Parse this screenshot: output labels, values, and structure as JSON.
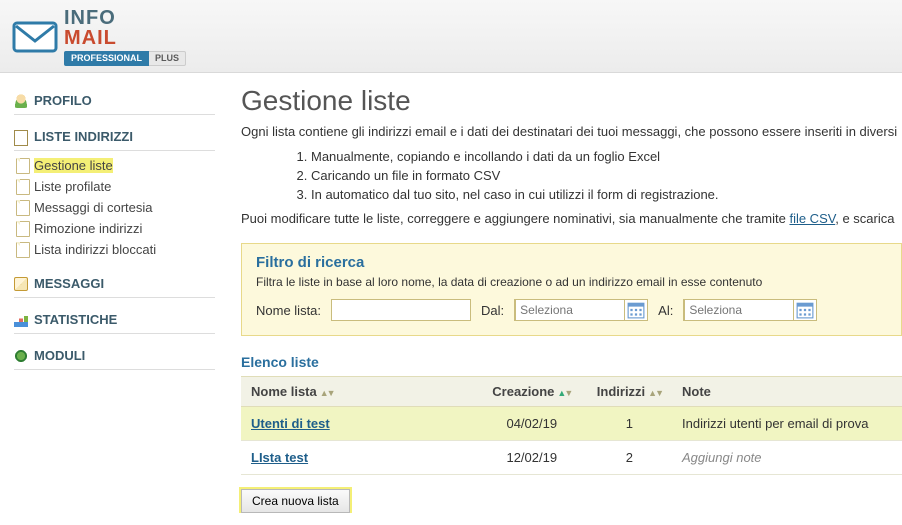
{
  "logo": {
    "line1": "INFO",
    "line2": "MAIL",
    "badge1": "PROFESSIONAL",
    "badge2": "PLUS"
  },
  "nav": {
    "profilo": "PROFILO",
    "liste": "LISTE INDIRIZZI",
    "liste_items": [
      {
        "label": "Gestione liste",
        "active": true
      },
      {
        "label": "Liste profilate"
      },
      {
        "label": "Messaggi di cortesia"
      },
      {
        "label": "Rimozione indirizzi"
      },
      {
        "label": "Lista indirizzi bloccati"
      }
    ],
    "messaggi": "MESSAGGI",
    "statistiche": "STATISTICHE",
    "moduli": "MODULI"
  },
  "page": {
    "title": "Gestione liste",
    "intro1": "Ogni lista contiene gli indirizzi email e i dati dei destinatari dei tuoi messaggi, che possono essere inseriti in diversi",
    "ol1": "Manualmente, copiando e incollando i dati da un foglio Excel",
    "ol2": "Caricando un file in formato CSV",
    "ol3": "In automatico dal tuo sito, nel caso in cui utilizzi il form di registrazione.",
    "intro2a": "Puoi modificare tutte le liste, correggere e aggiungere nominativi, sia manualmente che tramite ",
    "intro2_link": "file CSV",
    "intro2b": ", e scarica"
  },
  "filter": {
    "title": "Filtro di ricerca",
    "desc": "Filtra le liste in base al loro nome, la data di creazione o ad un indirizzo email in esse contenuto",
    "nome_label": "Nome lista:",
    "dal_label": "Dal:",
    "al_label": "Al:",
    "dal_placeholder": "Seleziona",
    "al_placeholder": "Seleziona"
  },
  "list": {
    "heading": "Elenco liste",
    "cols": {
      "nome": "Nome lista",
      "creazione": "Creazione",
      "indirizzi": "Indirizzi",
      "note": "Note"
    },
    "empty_note": "Aggiungi note",
    "rows": [
      {
        "nome": "Utenti di test",
        "creazione": "04/02/19",
        "indirizzi": "1",
        "note": "Indirizzi utenti per email di prova",
        "hl": true
      },
      {
        "nome": "LIsta test",
        "creazione": "12/02/19",
        "indirizzi": "2",
        "note": "",
        "hl": false
      }
    ]
  },
  "create_btn": "Crea nuova lista"
}
